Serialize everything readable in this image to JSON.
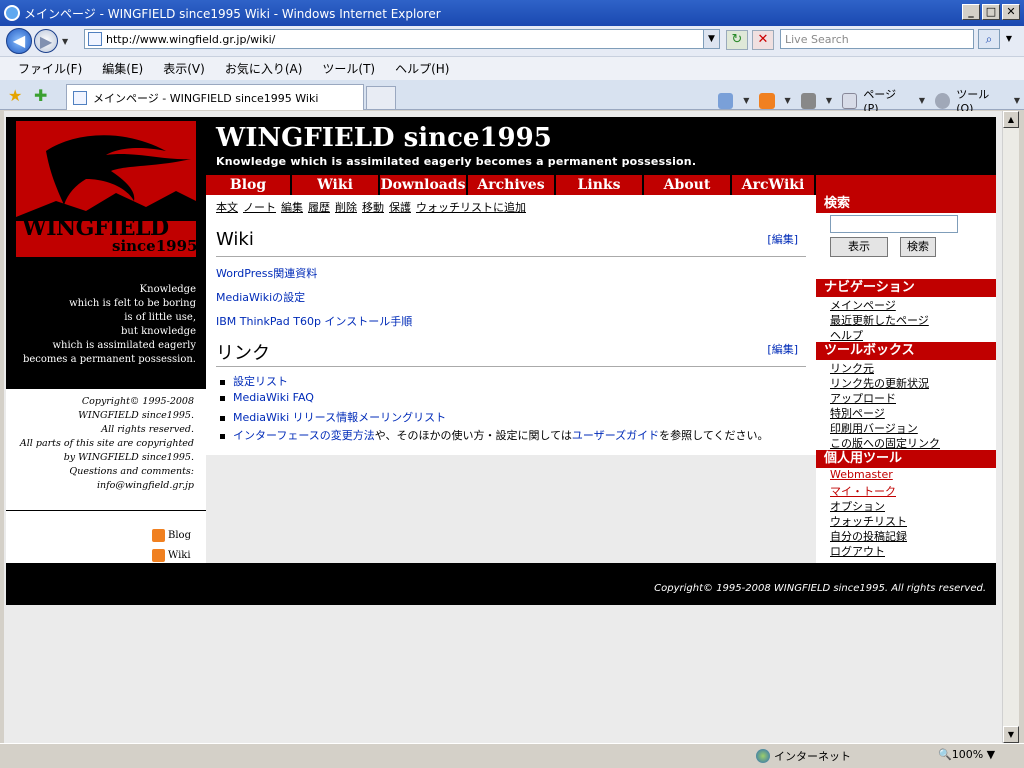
{
  "window": {
    "title": "メインページ - WINGFIELD since1995 Wiki - Windows Internet Explorer"
  },
  "address": {
    "url": "http://www.wingfield.gr.jp/wiki/"
  },
  "search": {
    "placeholder": "Live Search"
  },
  "menu": [
    "ファイル(F)",
    "編集(E)",
    "表示(V)",
    "お気に入り(A)",
    "ツール(T)",
    "ヘルプ(H)"
  ],
  "tab": {
    "title": "メインページ - WINGFIELD since1995 Wiki"
  },
  "toolbar": {
    "page": "ページ(P)",
    "tools": "ツール(O)"
  },
  "status": {
    "zone": "インターネット",
    "zoom": "100%"
  },
  "site": {
    "name": "WINGFIELD since1995",
    "tagline": "Knowledge which is assimilated eagerly becomes a permanent possession.",
    "logo_text": "WINGFIELD",
    "logo_sub": "since1995"
  },
  "nav": [
    "Blog",
    "Wiki",
    "Downloads",
    "Archives",
    "Links",
    "About",
    "ArcWiki"
  ],
  "actions": [
    "本文",
    "ノート",
    "編集",
    "履歴",
    "削除",
    "移動",
    "保護",
    "ウォッチリストに追加"
  ],
  "motto": [
    "Knowledge",
    "which is felt to be boring",
    "is of little use,",
    "but knowledge",
    "which is assimilated eagerly",
    "becomes a permanent possession."
  ],
  "copyright_left": [
    "Copyright© 1995-2008",
    "WINGFIELD since1995.",
    "All rights reserved.",
    "All parts of this site are copyrighted",
    "by WINGFIELD since1995.",
    "Questions and comments:",
    "info@wingfield.gr.jp"
  ],
  "feeds": [
    "Blog",
    "Wiki"
  ],
  "sections": {
    "wiki": {
      "title": "Wiki",
      "edit": "[編集]",
      "links": [
        "WordPress関連資料",
        "MediaWikiの設定",
        "IBM ThinkPad T60p インストール手順"
      ]
    },
    "links": {
      "title": "リンク",
      "edit": "[編集]",
      "items": [
        "設定リスト",
        "MediaWiki FAQ",
        "MediaWiki リリース情報メーリングリスト"
      ],
      "last": {
        "a": "インターフェースの変更方法",
        "mid": "や、そのほかの使い方・設定に関しては",
        "b": "ユーザーズガイド",
        "end": "を参照してください。"
      }
    }
  },
  "sidebar": {
    "search_title": "検索",
    "btn_show": "表示",
    "btn_search": "検索",
    "nav_title": "ナビゲーション",
    "nav": [
      "メインページ",
      "最近更新したページ",
      "ヘルプ"
    ],
    "tools_title": "ツールボックス",
    "tools": [
      "リンク元",
      "リンク先の更新状況",
      "アップロード",
      "特別ページ",
      "印刷用バージョン",
      "この版への固定リンク"
    ],
    "personal_title": "個人用ツール",
    "personal": [
      "Webmaster",
      "マイ・トーク",
      "オプション",
      "ウォッチリスト",
      "自分の投稿記録",
      "ログアウト"
    ]
  },
  "footer": {
    "text": "Copyright© 1995-2008 WINGFIELD since1995. All rights reserved."
  }
}
